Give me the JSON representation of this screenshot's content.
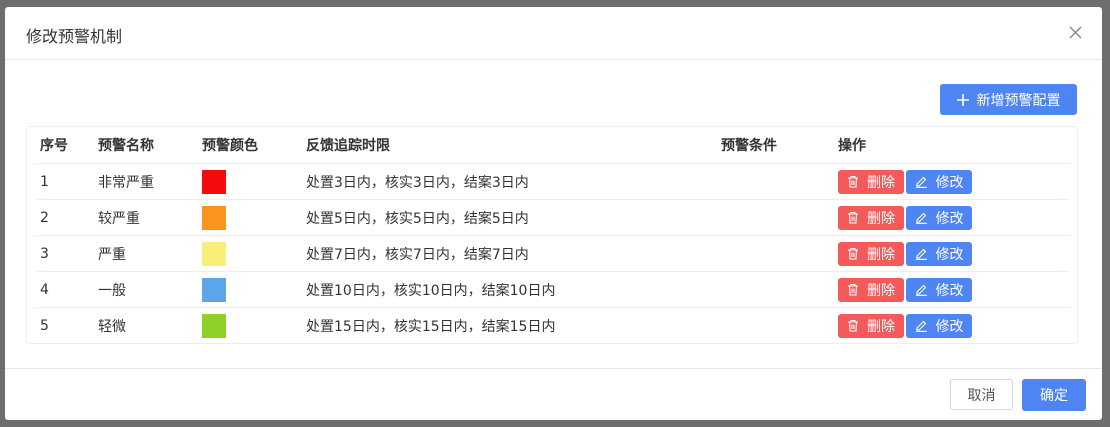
{
  "dialog": {
    "title": "修改预警机制",
    "add_button": "新增预警配置",
    "cancel_label": "取消",
    "ok_label": "确定"
  },
  "table": {
    "headers": [
      "序号",
      "预警名称",
      "预警颜色",
      "反馈追踪时限",
      "预警条件",
      "操作"
    ],
    "delete_label": "删除",
    "edit_label": "修改",
    "rows": [
      {
        "no": "1",
        "name": "非常严重",
        "color": "#f40c0c",
        "limit": "处置3日内，核实3日内，结案3日内",
        "condition": ""
      },
      {
        "no": "2",
        "name": "较严重",
        "color": "#f7951e",
        "limit": "处置5日内，核实5日内，结案5日内",
        "condition": ""
      },
      {
        "no": "3",
        "name": "严重",
        "color": "#f7ef7a",
        "limit": "处置7日内，核实7日内，结案7日内",
        "condition": ""
      },
      {
        "no": "4",
        "name": "一般",
        "color": "#5ba5e8",
        "limit": "处置10日内，核实10日内，结案10日内",
        "condition": ""
      },
      {
        "no": "5",
        "name": "轻微",
        "color": "#8fd126",
        "limit": "处置15日内，核实15日内，结案15日内",
        "condition": ""
      }
    ]
  },
  "colors": {
    "primary": "#4e85f2",
    "danger": "#f55a5a"
  }
}
